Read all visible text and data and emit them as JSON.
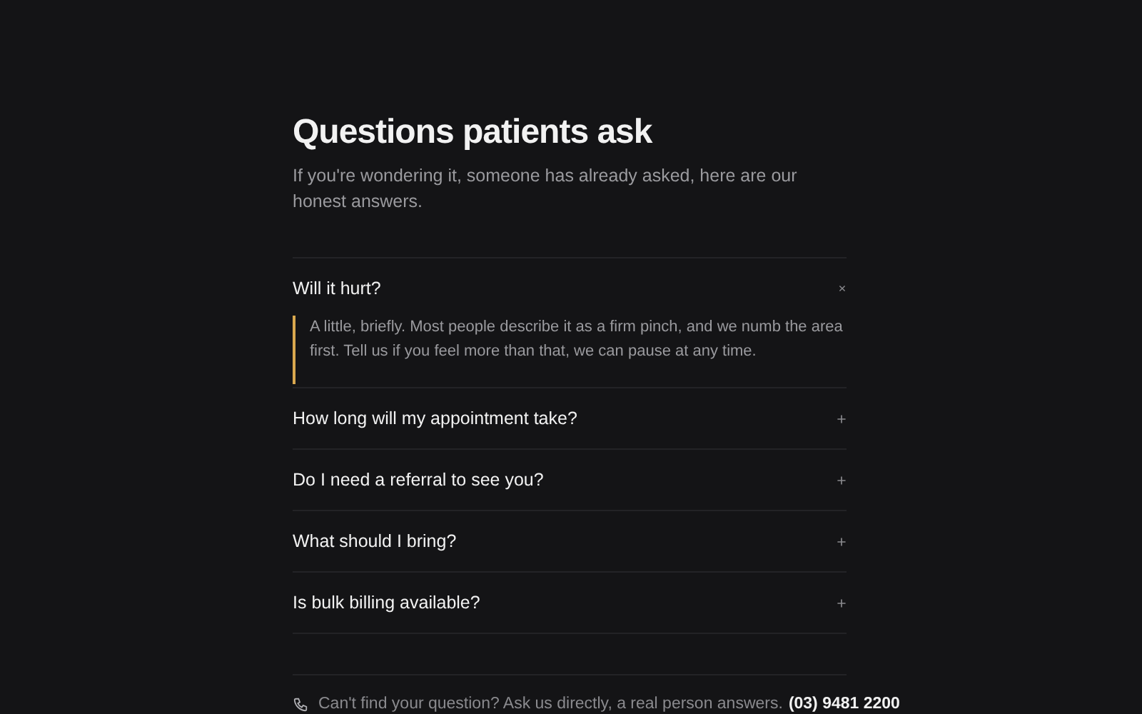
{
  "title": "Questions patients ask",
  "subtitle": "If you're wondering it, someone has already asked, here are our honest answers.",
  "faq": [
    {
      "question": "Will it hurt?",
      "expanded": true,
      "answer": "A little, briefly. Most people describe it as a firm pinch, and we numb the area first. Tell us if you feel more than that, we can pause at any time."
    },
    {
      "question": "How long will my appointment take?",
      "expanded": false
    },
    {
      "question": "Do I need a referral to see you?",
      "expanded": false
    },
    {
      "question": "What should I bring?",
      "expanded": false
    },
    {
      "question": "Is bulk billing available?",
      "expanded": false
    }
  ],
  "footer": {
    "text": "Can't find your question? Ask us directly, a real person answers.",
    "phone": "(03) 9481 2200"
  }
}
